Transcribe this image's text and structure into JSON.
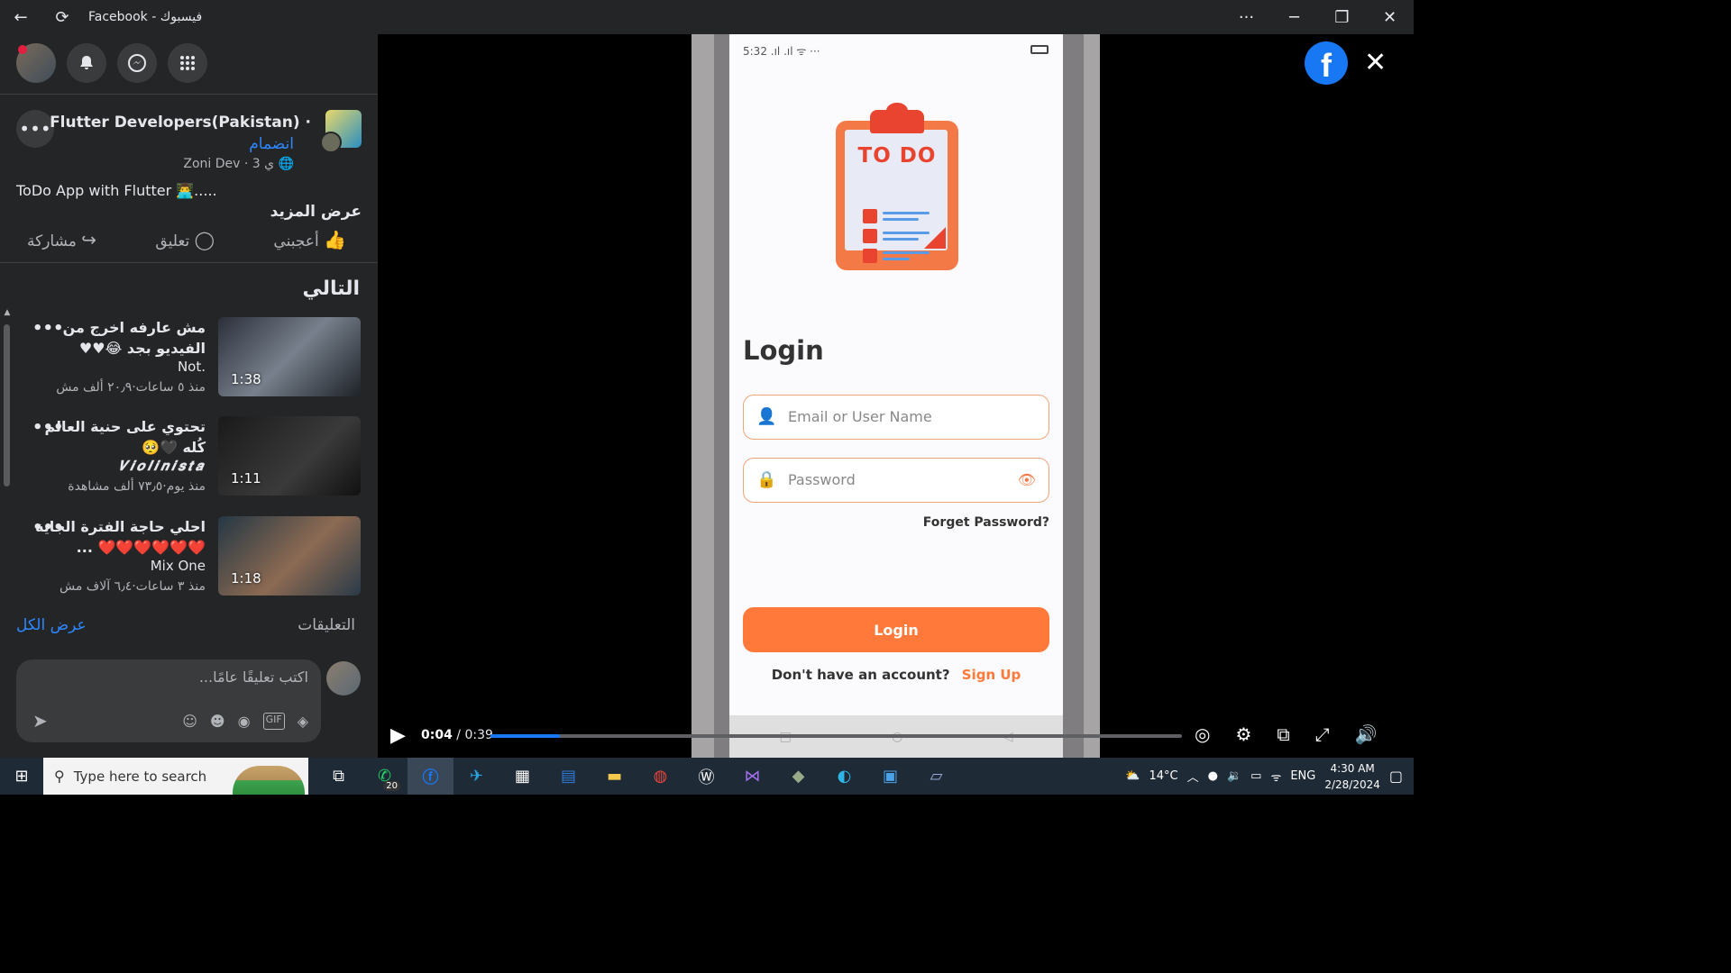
{
  "window": {
    "title": "Facebook - فيسبوك",
    "back_icon": "←",
    "refresh_icon": "⟳",
    "more_icon": "···",
    "minimize_icon": "─",
    "restore_icon": "❐",
    "close_icon": "✕"
  },
  "post": {
    "group_name": "Flutter Developers(Pakistan) ·",
    "join": "انضمام",
    "meta": "Zoni Dev · 3 ي 🌐",
    "text": "ToDo App with Flutter 👨‍💻.....",
    "see_more": "عرض المزيد",
    "more_dots": "•••",
    "actions": {
      "like": "أعجبني",
      "comment": "تعليق",
      "share": "مشاركة"
    }
  },
  "next": {
    "title": "التالي",
    "items": [
      {
        "title": "مش عارفه اخرج من الفيديو بجد 😂♥♥",
        "author": "Not.",
        "stats": "منذ ٥ ساعات·٢٠٫٩ ألف مش",
        "duration": "1:38"
      },
      {
        "title": "تحتوي على حنية العالم كُله 🖤🥺",
        "author": "𝑽𝒊𝒐𝒍𝒊𝒏𝒊𝒔𝒕𝒂",
        "stats": "منذ يوم·٧٣٫٥ ألف مشاهدة",
        "duration": "1:11"
      },
      {
        "title": "احلي حاجة الفترة الجاية ❤️❤️❤️❤️❤️❤️ ...",
        "author": "Mix One",
        "stats": "منذ ٣ ساعات·٦٫٤ آلاف مش",
        "duration": "1:18"
      }
    ]
  },
  "comments": {
    "label": "التعليقات",
    "see_all": "عرض الكل",
    "placeholder": "اكتب تعليقًا عامًا..."
  },
  "app_screen": {
    "status_time": "5:32",
    "status_icons": ".ıl .ıl ᯤ ···",
    "clip_label": "TO DO",
    "login_title": "Login",
    "email_placeholder": "Email or User Name",
    "password_placeholder": "Password",
    "forgot": "Forget Password?",
    "login_button": "Login",
    "no_account": "Don't have an account?",
    "sign_up": "Sign Up"
  },
  "player": {
    "current_time": "0:04",
    "separator": " / ",
    "duration": "0:39",
    "progress": 0.1
  },
  "taskbar": {
    "search_placeholder": "Type here to search",
    "whatsapp_badge": "20",
    "weather": "14°C",
    "language": "ENG",
    "time": "4:30 AM",
    "date": "2/28/2024"
  },
  "colors": {
    "facebook_blue": "#1877f2",
    "app_orange": "#ff7a3a",
    "panel_bg": "#242526"
  }
}
